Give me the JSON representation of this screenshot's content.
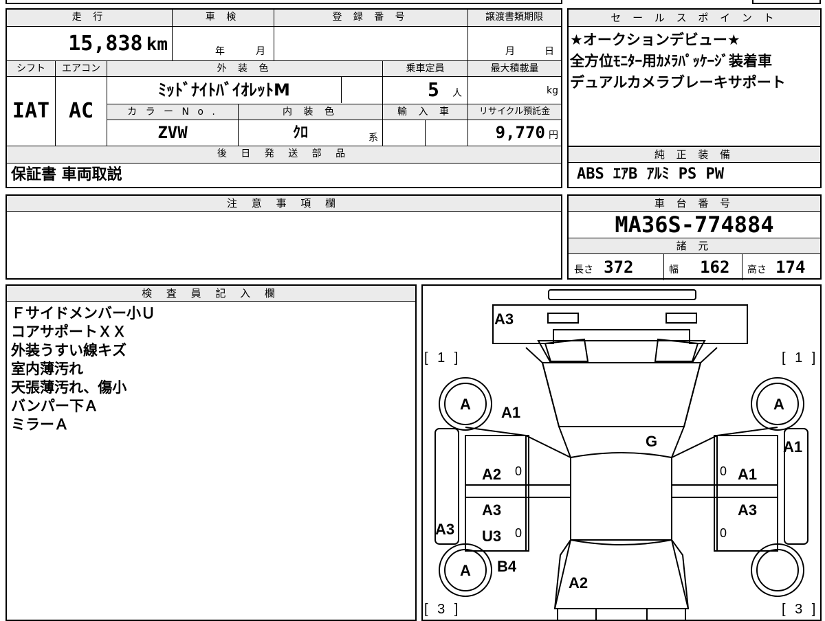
{
  "main": {
    "headers": {
      "mileage": "走 行",
      "inspection": "車 検",
      "registration": "登 録 番 号",
      "transfer_deadline": "譲渡書類期限",
      "shift": "シフト",
      "aircon": "エアコン",
      "exterior_color": "外 装 色",
      "capacity": "乗車定員",
      "max_load": "最大積載量",
      "color_no": "カ ラ ー N o .",
      "interior_color": "内 装 色",
      "import": "輸 入 車",
      "recycle": "リサイクル預託金",
      "later_parts": "後 日 発 送 部 品",
      "notes": "注 意 事 項 欄",
      "inspector": "検 査 員 記 入 欄"
    },
    "mileage_value": "15,838",
    "mileage_unit": "km",
    "year_label": "年",
    "month_label": "月",
    "deadline_month": "月",
    "deadline_day": "日",
    "shift_value": "IAT",
    "aircon_value": "AC",
    "exterior_value": "ﾐｯﾄﾞﾅｲﾄﾊﾞｲｵﾚｯﾄM",
    "capacity_value": "5",
    "capacity_unit": "人",
    "max_load_unit": "kg",
    "color_no_value": "ZVW",
    "interior_value": "ｸﾛ",
    "interior_suffix": "系",
    "recycle_value": "9,770",
    "recycle_unit": "円",
    "later_parts_value": "保証書 車両取説",
    "inspector_lines": [
      "Ｆサイドメンバー小Ｕ",
      "コアサポートＸＸ",
      "外装うすい線キズ",
      "室内薄汚れ",
      "天張薄汚れ、傷小",
      "バンパー下Ａ",
      "ミラーＡ"
    ]
  },
  "side": {
    "sales_header": "セ ー ル ス ポ イ ン ト",
    "sales_lines": [
      "★オークションデビュー★",
      "全方位ﾓﾆﾀｰ用ｶﾒﾗﾊﾟｯｹｰｼﾞ装着車",
      "デュアルカメラブレーキサポート"
    ],
    "equipment_header": "純 正 装 備",
    "equipment_value": "ABS ｴｱB ｱﾙﾐ PS PW",
    "chassis_header": "車 台 番 号",
    "chassis_value": "MA36S-774884",
    "spec_header": "諸 元",
    "length_label": "長さ",
    "length_value": "372",
    "width_label": "幅",
    "width_value": "162",
    "height_label": "高さ",
    "height_value": "174"
  },
  "diagram": {
    "labels": {
      "front_bumper": "A3",
      "bracket_top_left": "[ 1 ]",
      "bracket_top_right": "[ 1 ]",
      "bracket_bottom_left": "[ 3 ]",
      "bracket_bottom_right": "[ 3 ]",
      "front_left_wheel": "A",
      "front_right_wheel": "A",
      "rear_left_wheel": "A",
      "hood_left": "A1",
      "windshield": "G",
      "right_fender": "A1",
      "front_left_door": "A2",
      "front_right_door": "A1",
      "rear_left_door_a": "A3",
      "rear_left_door_u": "U3",
      "rear_right_door": "A3",
      "left_side_sill": "A3",
      "left_rear_quarter": "B4",
      "rear_glass": "A2",
      "zero_fl": "0",
      "zero_fr": "0",
      "zero_rl": "0",
      "zero_rr": "0"
    }
  }
}
